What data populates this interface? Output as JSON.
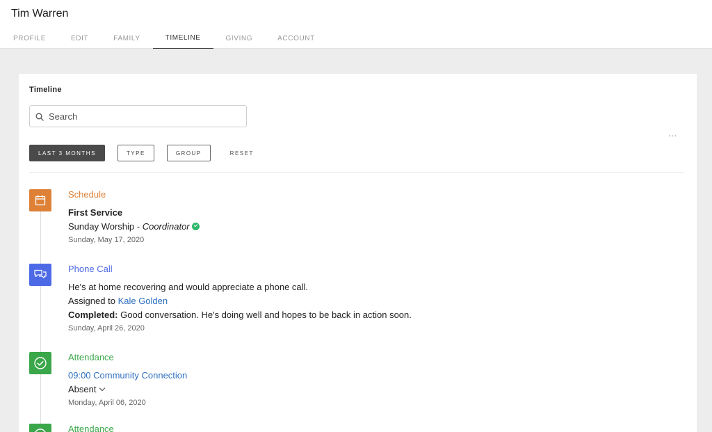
{
  "header": {
    "person_name": "Tim Warren",
    "tabs": [
      {
        "label": "PROFILE"
      },
      {
        "label": "EDIT"
      },
      {
        "label": "FAMILY"
      },
      {
        "label": "TIMELINE",
        "active": true
      },
      {
        "label": "GIVING"
      },
      {
        "label": "ACCOUNT"
      }
    ]
  },
  "timeline": {
    "title": "Timeline",
    "search_placeholder": "Search",
    "more_label": "...",
    "filters": {
      "last3": "LAST 3 MONTHS",
      "type": "TYPE",
      "group": "GROUP",
      "reset": "RESET"
    },
    "items": [
      {
        "type": "Schedule",
        "color": "#de8137",
        "icon": "calendar-icon",
        "title": "First Service",
        "detail_prefix": "Sunday Worship - ",
        "detail_role": "Coordinator",
        "date": "Sunday, May 17, 2020"
      },
      {
        "type": "Phone Call",
        "color": "#4d6ae6",
        "icon": "chat-icon",
        "note": "He's at home recovering and would appreciate a phone call.",
        "assigned_prefix": "Assigned to",
        "assignee": "Kale Golden",
        "completed_label": "Completed:",
        "completed_text": "Good conversation. He's doing well and hopes to be back in action soon.",
        "date": "Sunday, April 26, 2020"
      },
      {
        "type": "Attendance",
        "color": "#3aa74a",
        "icon": "check-circle-icon",
        "event": "09:00 Community Connection",
        "status": "Absent",
        "date": "Monday, April 06, 2020"
      },
      {
        "type": "Attendance",
        "color": "#3aa74a",
        "icon": "check-circle-icon"
      }
    ]
  }
}
